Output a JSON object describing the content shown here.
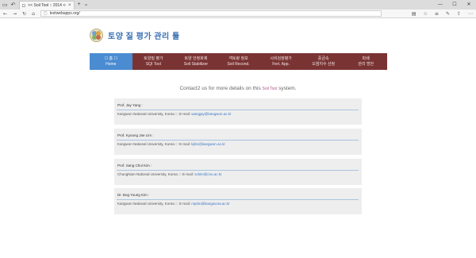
{
  "browser": {
    "tab_title": "<< Soil Tool :: 2014 <<",
    "tab_close": "×",
    "new_tab": "+",
    "tab_menu": "⌄",
    "url": "testwebapps.org/",
    "window_controls": [
      "—",
      "☐",
      "✕"
    ]
  },
  "site": {
    "logo_text": "토양 질 평가 관리 툴"
  },
  "menu": {
    "items": [
      {
        "line1": "☐ 홈 ☐",
        "line2": "Home"
      },
      {
        "line1": "토양질 평가",
        "line2": "SQI Tool"
      },
      {
        "line1": "토양 안정화제",
        "line2": "Soil Stabilizer"
      },
      {
        "line1": "객토량 정보",
        "line2": "Soil Recond."
      },
      {
        "line1": "시비검정평가",
        "line2": "Fert. App."
      },
      {
        "line1": "중금속",
        "line2": "오염지수 산정"
      },
      {
        "line1": "파쇄",
        "line2": "관리 방안"
      }
    ]
  },
  "contact": {
    "prefix": "Contact2 us for more details on this",
    "brand": "Soil Tool",
    "suffix": "system."
  },
  "people": [
    {
      "name": "Prof. Jay Yang :",
      "affiliation": "Kangwon National University, Korea ::: E-mail:",
      "email": "wangjay@kangwon.ac.kr"
    },
    {
      "name": "Prof. Kyoung Jae Lim :",
      "affiliation": "Kangwon National University, Korea ::: E-mail:",
      "email": "kjlim@kangwon.ac.kr"
    },
    {
      "name": "Prof. Sang Chul Kim :",
      "affiliation": "ChungNam National University, Korea ::: E-mail:",
      "email": "sckim@cnu.ac.kr"
    },
    {
      "name": "Dr. Bog Young Kim :",
      "affiliation": "Kangwon National University, Korea ::: E-mail:",
      "email": "rsptim@kangwona.ac.kr"
    }
  ]
}
